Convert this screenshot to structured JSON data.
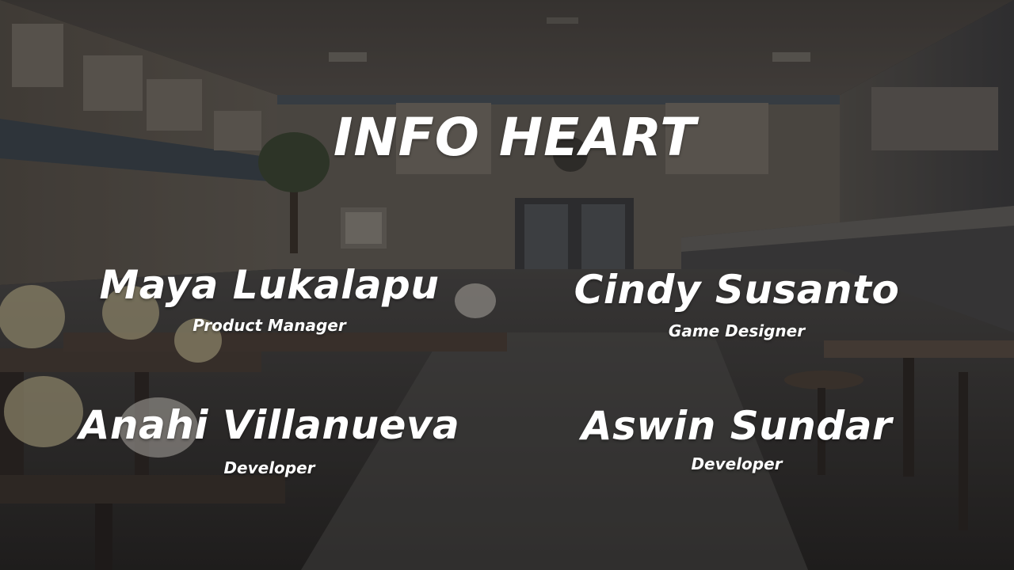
{
  "screen": {
    "title": "INFO HEART",
    "background_scene": "school-cafeteria"
  },
  "credits": [
    {
      "name": "Maya Lukalapu",
      "role": "Product Manager"
    },
    {
      "name": "Cindy Susanto",
      "role": "Game Designer"
    },
    {
      "name": "Anahi Villanueva",
      "role": "Developer"
    },
    {
      "name": "Aswin Sundar",
      "role": "Developer"
    }
  ],
  "colors": {
    "text": "#ffffff",
    "overlay": "#141212"
  }
}
